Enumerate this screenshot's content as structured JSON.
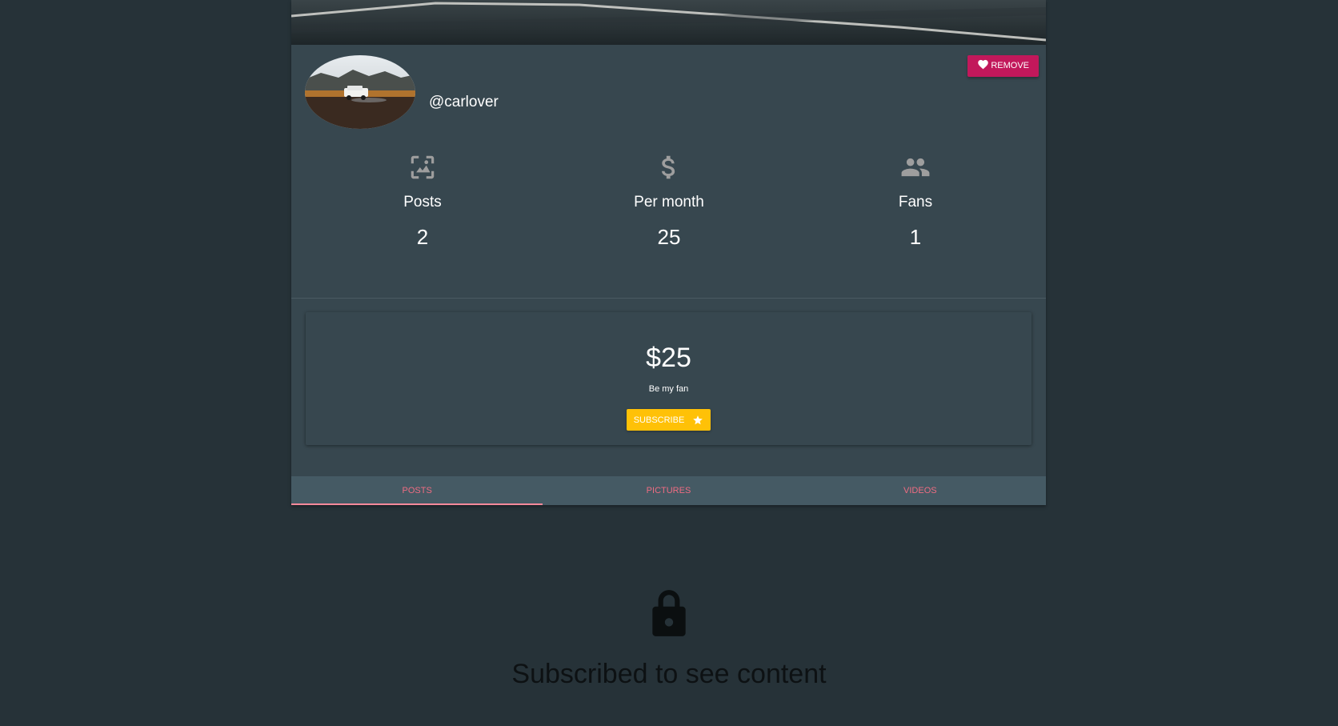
{
  "profile": {
    "username": "@carlover",
    "remove_label": "REMOVE"
  },
  "stats": [
    {
      "icon": "image-icon",
      "label": "Posts",
      "value": "2"
    },
    {
      "icon": "dollar-icon",
      "label": "Per month",
      "value": "25"
    },
    {
      "icon": "people-icon",
      "label": "Fans",
      "value": "1"
    }
  ],
  "subscription": {
    "price": "$25",
    "tagline": "Be my fan",
    "subscribe_label": "SUBSCRIBE"
  },
  "tabs": [
    {
      "label": "POSTS",
      "active": true
    },
    {
      "label": "PICTURES",
      "active": false
    },
    {
      "label": "VIDEOS",
      "active": false
    }
  ],
  "locked": {
    "message": "Subscribed to see content"
  },
  "colors": {
    "background": "#263238",
    "card": "#37474f",
    "tab_bar": "#455a64",
    "remove_button": "#c2185b",
    "subscribe_button": "#ffc107",
    "tab_text": "#ef6c82"
  }
}
